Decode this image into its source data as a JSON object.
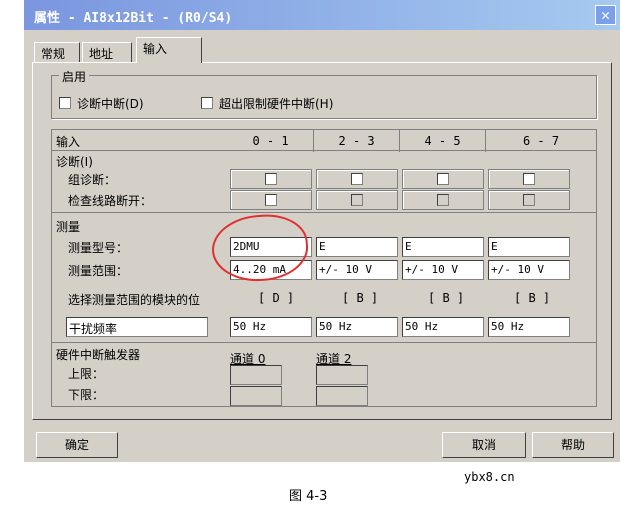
{
  "window": {
    "title": "属性 - AI8x12Bit - (R0/S4)",
    "close_glyph": "✕"
  },
  "tabs": [
    {
      "label": "常规"
    },
    {
      "label": "地址"
    },
    {
      "label": "输入"
    }
  ],
  "enable_group": {
    "title": "启用",
    "diag_interrupt": "诊断中断(D)",
    "hw_limit_interrupt": "超出限制硬件中断(H)"
  },
  "table": {
    "header": {
      "input": "输入",
      "cols": [
        "0 - 1",
        "2 - 3",
        "4 - 5",
        "6 - 7"
      ]
    },
    "diagnostics": {
      "title": "诊断(I)",
      "group_diag": "组诊断：",
      "wire_break": "检查线路断开："
    },
    "measurement": {
      "title": "测量",
      "type_label": "测量型号：",
      "range_label": "测量范围：",
      "types": [
        "2DMU",
        "E",
        "E",
        "E"
      ],
      "ranges": [
        "4..20 mA",
        "+/- 10 V",
        "+/- 10 V",
        "+/- 10 V"
      ],
      "module_pos_label": "选择测量范围的模块的位",
      "module_pos": [
        "[ D ]",
        "[ B ]",
        "[ B ]",
        "[ B ]"
      ],
      "interference_label": "干扰频率",
      "interference": [
        "50 Hz",
        "50 Hz",
        "50 Hz",
        "50 Hz"
      ]
    },
    "hw_trigger": {
      "title": "硬件中断触发器",
      "channel0": "通道 0",
      "channel2": "通道 2",
      "upper": "上限：",
      "lower": "下限："
    }
  },
  "buttons": {
    "ok": "确定",
    "cancel": "取消",
    "help": "帮助"
  },
  "watermark": "ybx8.cn",
  "caption": "图 4-3"
}
